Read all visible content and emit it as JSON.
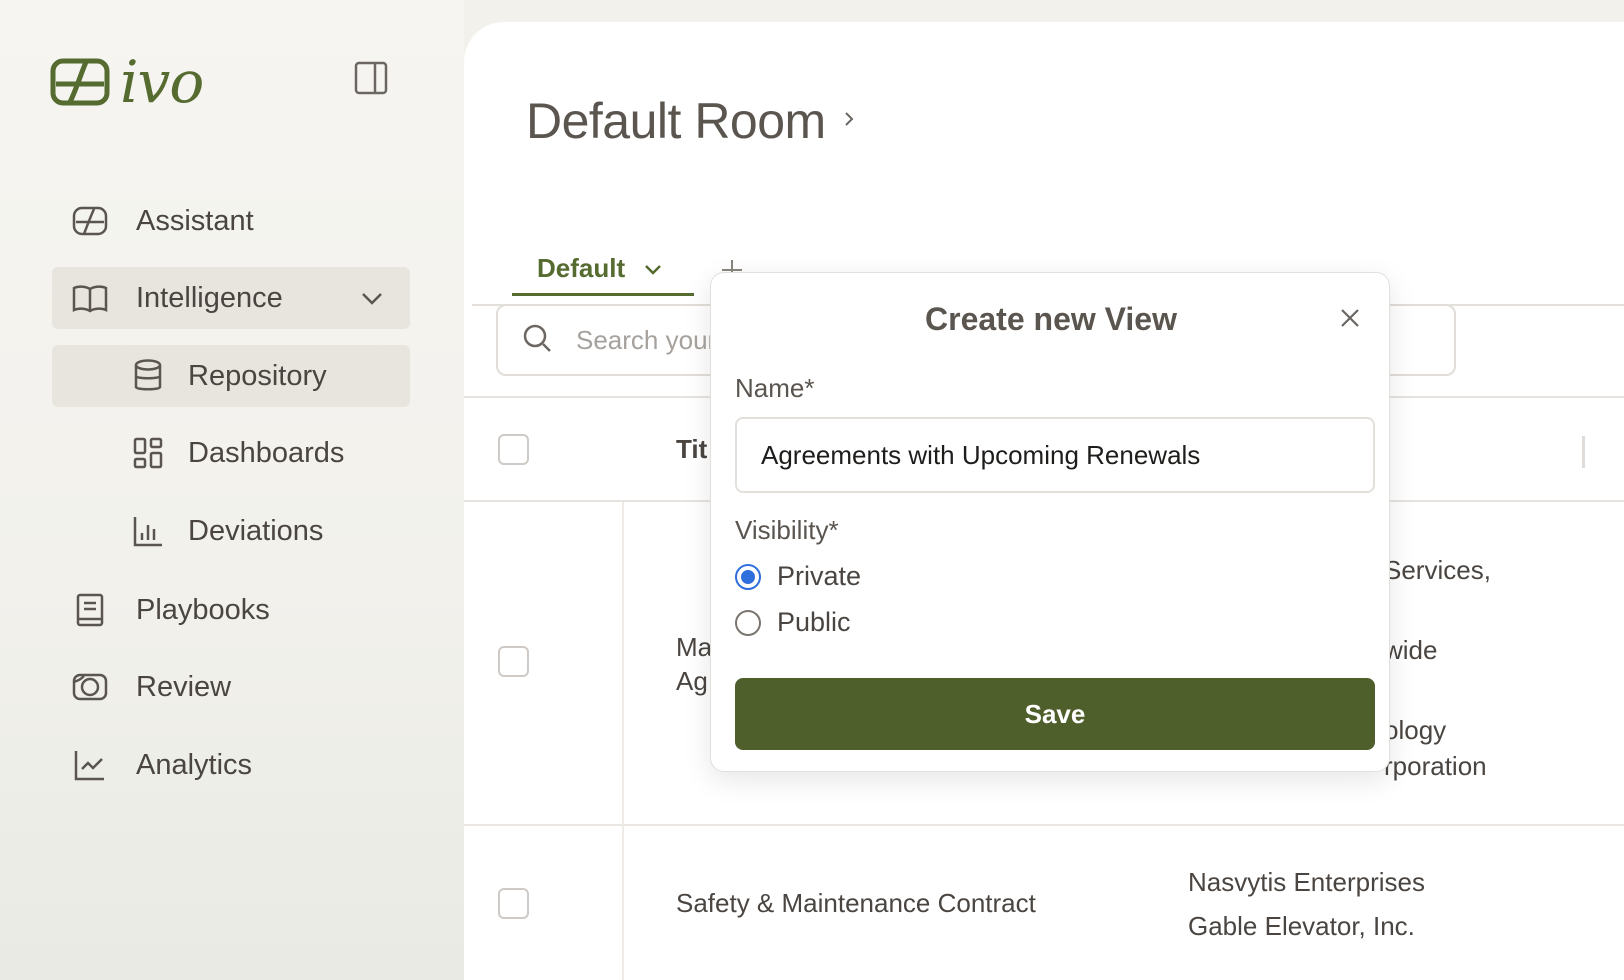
{
  "brand": {
    "name": "ivo",
    "accent": "#556b2f"
  },
  "sidebar": {
    "items": [
      {
        "label": "Assistant",
        "icon": "assistant-icon"
      },
      {
        "label": "Intelligence",
        "icon": "book-open-icon",
        "expanded": true
      },
      {
        "label": "Repository",
        "icon": "database-icon",
        "active": true
      },
      {
        "label": "Dashboards",
        "icon": "layout-grid-icon"
      },
      {
        "label": "Deviations",
        "icon": "bar-chart-icon"
      },
      {
        "label": "Playbooks",
        "icon": "notebook-icon"
      },
      {
        "label": "Review",
        "icon": "review-icon"
      },
      {
        "label": "Analytics",
        "icon": "line-chart-icon"
      }
    ]
  },
  "main": {
    "title": "Default Room",
    "tabs": [
      {
        "label": "Default"
      }
    ],
    "search": {
      "placeholder": "Search your"
    },
    "table": {
      "header": {
        "title": "Tit"
      },
      "rows": [
        {
          "title_lines": [
            "Ma",
            "Ag"
          ],
          "parties": [
            "Services,",
            "wide",
            "ology",
            "rporation"
          ]
        },
        {
          "title_lines": [
            "Safety & Maintenance Contract"
          ],
          "parties": [
            "Nasvytis Enterprises",
            "Gable Elevator, Inc."
          ]
        }
      ]
    }
  },
  "modal": {
    "title": "Create new View",
    "name_label": "Name*",
    "name_value": "Agreements with Upcoming Renewals",
    "visibility_label": "Visibility*",
    "options": [
      {
        "label": "Private",
        "selected": true
      },
      {
        "label": "Public",
        "selected": false
      }
    ],
    "save_label": "Save"
  }
}
